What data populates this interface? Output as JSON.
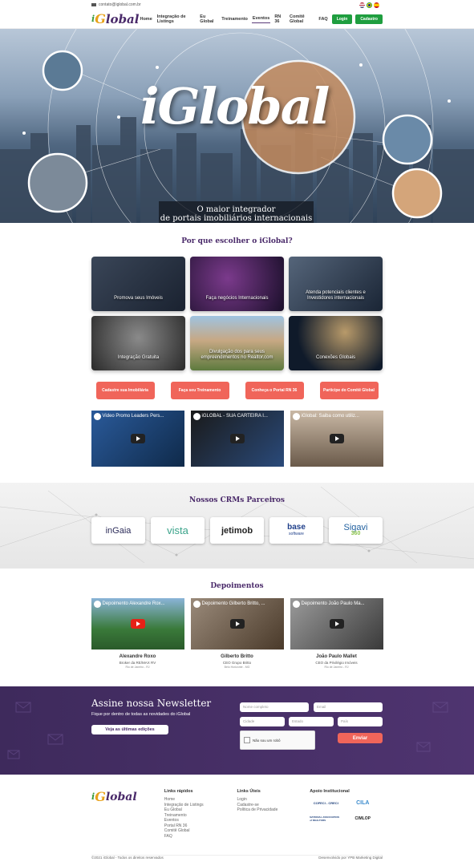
{
  "topbar": {
    "email": "contato@iglobal.com.br"
  },
  "header": {
    "logo": {
      "i": "i",
      "g": "G",
      "rest": "lobal"
    },
    "nav": [
      "Home",
      "Integração de Listings",
      "Eu Global",
      "Treinamento",
      "Eventos",
      "RN 36",
      "Comitê Global",
      "FAQ"
    ],
    "login_label": "Login",
    "signup_label": "Cadastro"
  },
  "hero": {
    "title": "iGlobal",
    "subtitle_line1": "O maior integrador",
    "subtitle_line2": "de portais imobiliários internacionais"
  },
  "why": {
    "title": "Por que escolher o iGlobal?",
    "cards": [
      {
        "label": "Promova seus Imóveis",
        "color": "#2b3340"
      },
      {
        "label": "Faça negócios Internacionais",
        "color": "#3a1f4d"
      },
      {
        "label": "Atenda potenciais clientes e Investidores internacionais",
        "color": "#243245"
      },
      {
        "label": "Integração Gratuita",
        "color": "#4a4a4a"
      },
      {
        "label": "Divulgação dos para seus empreendimentos no Realtor.com",
        "color": "#6b7f4a"
      },
      {
        "label": "Conexões Globais",
        "color": "#1e2a3a"
      }
    ],
    "ctas": [
      "Cadastre sua Imobiliária",
      "Faça seu Treinamento",
      "Conheça o Portal RN 36",
      "Participe do Comitê Global"
    ],
    "videos": [
      {
        "title": "Video Promo Leaders Pers...",
        "color": "#1c3a66"
      },
      {
        "title": "iGLOBAL - SUA CARTEIRA I...",
        "color": "#1a1a1a"
      },
      {
        "title": "iGlobal: Saiba como utiliz...",
        "color": "#8c7a6a"
      }
    ]
  },
  "crm": {
    "title": "Nossos CRMs Parceiros",
    "logos": [
      {
        "name": "inGaia",
        "color": "#2d2d5a"
      },
      {
        "name": "vista",
        "color": "#3aa38a"
      },
      {
        "name": "jetimob",
        "color": "#222"
      },
      {
        "name": "base",
        "color": "#e53935"
      },
      {
        "name": "Sigavi",
        "color": "#1f5f9f"
      }
    ],
    "base_sub": "software",
    "sigavi_sub": "360"
  },
  "testimonials": {
    "title": "Depoimentos",
    "items": [
      {
        "video_title": "Depoimento Alexandre Rox...",
        "name": "Alexandre Roxo",
        "role": "Broker da RE/MAX RV",
        "city": "Rio de Janeiro - RJ",
        "color": "#4f7a3a"
      },
      {
        "video_title": "Depoimento Gilberto Britto, ...",
        "name": "Gilberto Britto",
        "role": "CEO Grupo Britto",
        "city": "Belo Horizonte - MG",
        "color": "#6b5a4a"
      },
      {
        "video_title": "Depoimento João Paulo Ma...",
        "name": "João Paulo Mallet",
        "role": "CEO da Privilégio Imóveis",
        "city": "Rio de Janeiro - RJ",
        "color": "#5a5a5a"
      }
    ]
  },
  "newsletter": {
    "title": "Assine nossa Newsletter",
    "text": "Fique por dentro de todas as novidades do iGlobal",
    "editions_label": "Veja as últimas edições",
    "placeholders": {
      "name": "Nome completo",
      "email": "Email",
      "city": "Cidade",
      "state": "Estado",
      "country": "País"
    },
    "captcha": "Não sou um robô",
    "send_label": "Enviar"
  },
  "footer": {
    "quick_links_title": "Links rápidos",
    "quick_links": [
      "Home",
      "Integração de Listings",
      "Eu Global",
      "Treinamento",
      "Eventos",
      "Portal RN 36",
      "Comitê Global",
      "FAQ"
    ],
    "useful_links_title": "Links Úteis",
    "useful_links": [
      "Login",
      "Cadastre-se",
      "Política de Privacidade"
    ],
    "support_title": "Apoio Institucional",
    "partners": [
      "COFECI - CRECI",
      "CILA",
      "NATIONAL ASSOCIATION of REALTORS",
      "CIMLOP"
    ],
    "copyright": "©2021 iGlobal - Todos os direitos reservados",
    "developer": "Desenvolvido por YPB Marketing Digital"
  }
}
